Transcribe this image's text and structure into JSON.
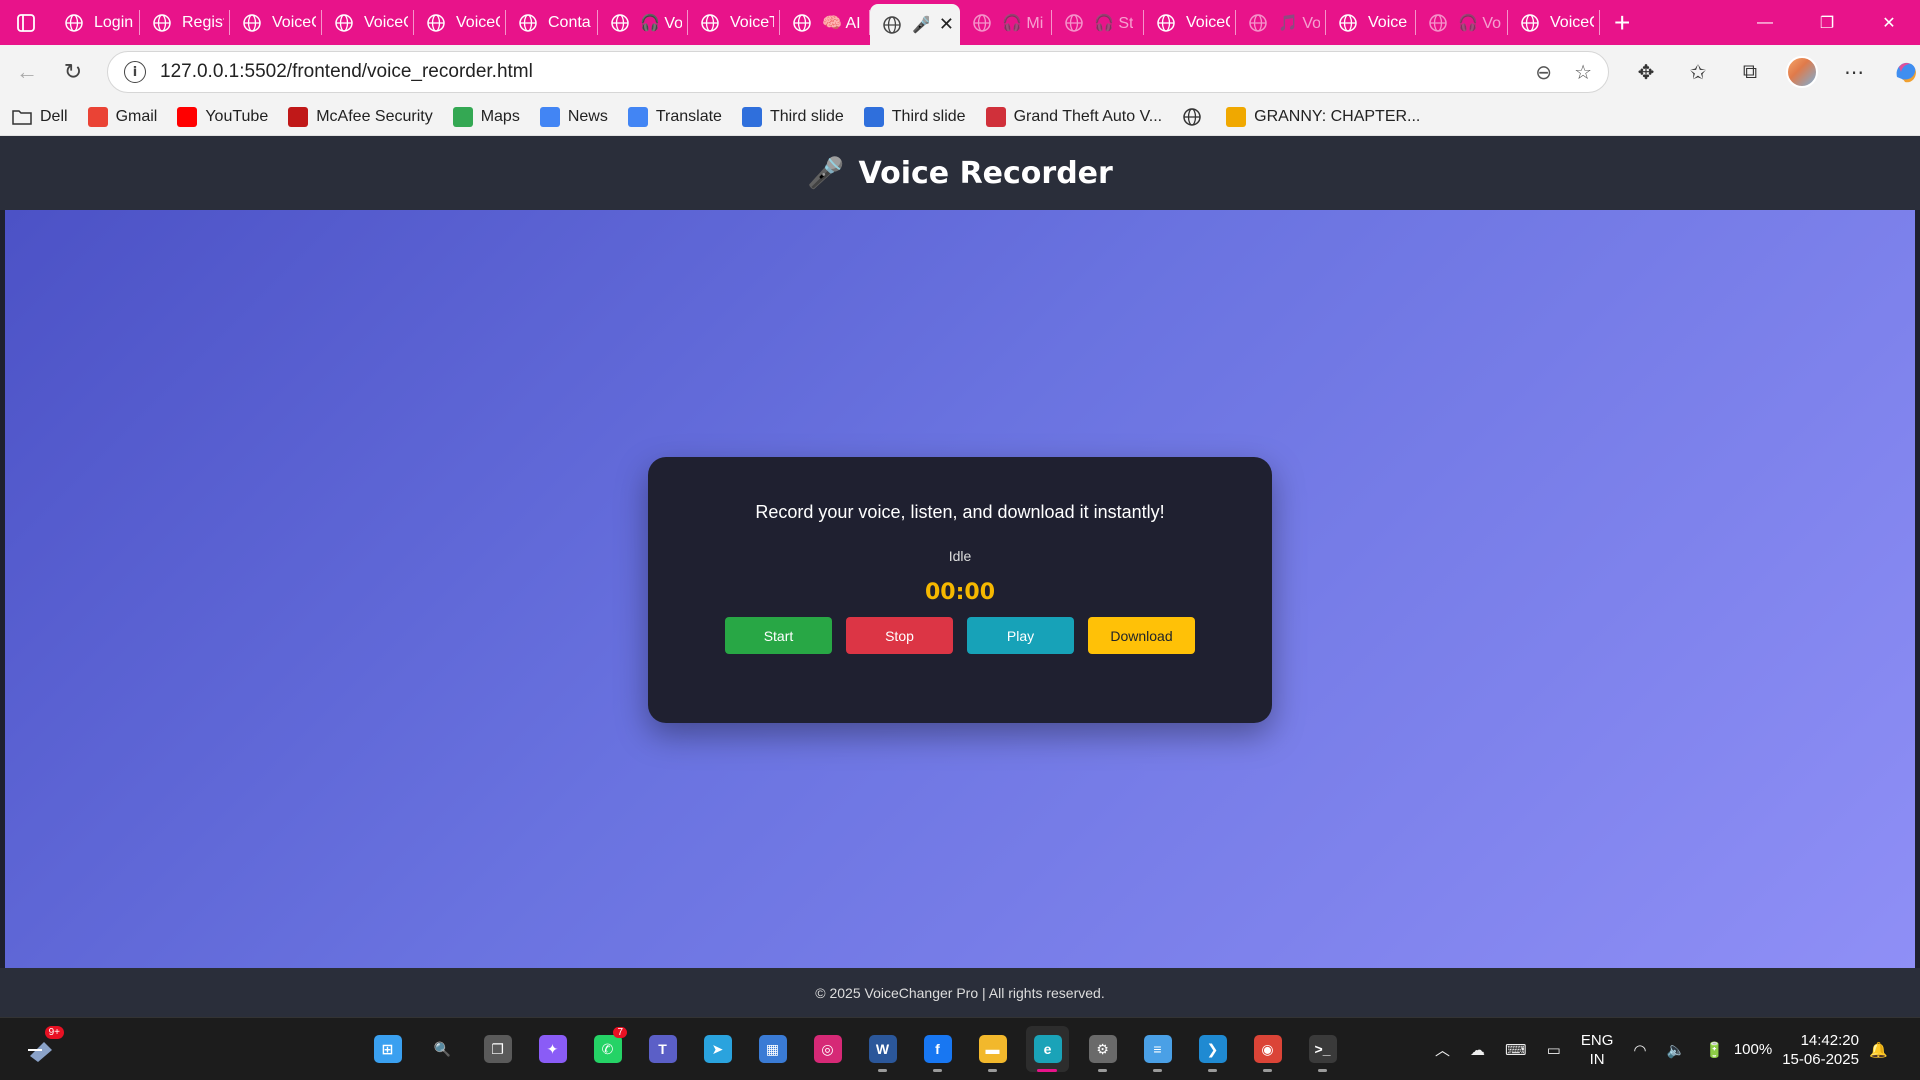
{
  "browser": {
    "tabs": [
      {
        "title": "Login",
        "dim": false
      },
      {
        "title": "Regist",
        "dim": false
      },
      {
        "title": "VoiceC",
        "dim": false
      },
      {
        "title": "VoiceC",
        "dim": false
      },
      {
        "title": "VoiceC",
        "dim": false
      },
      {
        "title": "Conta",
        "dim": false
      },
      {
        "title": "🎧 Vo",
        "dim": false
      },
      {
        "title": "VoiceT",
        "dim": false
      },
      {
        "title": "🧠 AI",
        "dim": false
      },
      {
        "title": "🎤",
        "dim": false,
        "active": true
      },
      {
        "title": "🎧 Mi",
        "dim": true
      },
      {
        "title": "🎧 St",
        "dim": true
      },
      {
        "title": "VoiceC",
        "dim": false
      },
      {
        "title": "🎵 Vo",
        "dim": true
      },
      {
        "title": "Voice",
        "dim": false
      },
      {
        "title": "🎧 Vo",
        "dim": true
      },
      {
        "title": "VoiceC",
        "dim": false
      }
    ],
    "url": "127.0.0.1:5502/frontend/voice_recorder.html",
    "bookmarks": [
      {
        "label": "Dell",
        "icon": "folder-icon",
        "color": "#ffffff"
      },
      {
        "label": "Gmail",
        "icon": "gmail-icon",
        "color": "#ea4335"
      },
      {
        "label": "YouTube",
        "icon": "youtube-icon",
        "color": "#ff0000"
      },
      {
        "label": "McAfee Security",
        "icon": "mcafee-icon",
        "color": "#c01818"
      },
      {
        "label": "Maps",
        "icon": "maps-icon",
        "color": "#34a853"
      },
      {
        "label": "News",
        "icon": "news-icon",
        "color": "#4285f4"
      },
      {
        "label": "Translate",
        "icon": "translate-icon",
        "color": "#4285f4"
      },
      {
        "label": "Third slide",
        "icon": "slide-icon",
        "color": "#2f6fdc"
      },
      {
        "label": "Third slide",
        "icon": "slide-icon",
        "color": "#2f6fdc"
      },
      {
        "label": "Grand Theft Auto V...",
        "icon": "gamepad-icon",
        "color": "#d0303a"
      },
      {
        "label": "",
        "icon": "globe-icon",
        "color": "#333333"
      },
      {
        "label": "GRANNY: CHAPTER...",
        "icon": "crown-icon",
        "color": "#f0a800"
      }
    ]
  },
  "page": {
    "header_title": "Voice Recorder",
    "tagline": "Record your voice, listen, and download it instantly!",
    "status": "Idle",
    "timer": "00:00",
    "buttons": {
      "start": "Start",
      "stop": "Stop",
      "play": "Play",
      "download": "Download"
    },
    "footer": "© 2025 VoiceChanger Pro | All rights reserved."
  },
  "taskbar": {
    "notification_badge": "9+",
    "apps": [
      {
        "name": "start-icon",
        "color": "#3aa0f0",
        "glyph": "⊞"
      },
      {
        "name": "search-icon",
        "color": "transparent",
        "glyph": "🔍"
      },
      {
        "name": "task-view-icon",
        "color": "#5a5a5a",
        "glyph": "❐"
      },
      {
        "name": "copilot-icon",
        "color": "#8a5cf6",
        "glyph": "✦"
      },
      {
        "name": "whatsapp-icon",
        "color": "#25d366",
        "glyph": "✆",
        "badge": "7"
      },
      {
        "name": "teams-icon",
        "color": "#5b5fc7",
        "glyph": "T"
      },
      {
        "name": "telegram-icon",
        "color": "#2aa3de",
        "glyph": "➤"
      },
      {
        "name": "store-icon",
        "color": "#3a7bd5",
        "glyph": "▦"
      },
      {
        "name": "instagram-icon",
        "color": "#d62976",
        "glyph": "◎"
      },
      {
        "name": "word-icon",
        "color": "#2b579a",
        "glyph": "W"
      },
      {
        "name": "facebook-icon",
        "color": "#1877f2",
        "glyph": "f"
      },
      {
        "name": "file-explorer-icon",
        "color": "#f2b82c",
        "glyph": "▬"
      },
      {
        "name": "edge-icon",
        "color": "#1aa3b8",
        "glyph": "e",
        "active": true
      },
      {
        "name": "settings-icon",
        "color": "#6a6a6a",
        "glyph": "⚙"
      },
      {
        "name": "notepad-icon",
        "color": "#4aa0e6",
        "glyph": "≡"
      },
      {
        "name": "vscode-icon",
        "color": "#1f8ad2",
        "glyph": "❯"
      },
      {
        "name": "chrome-icon",
        "color": "#db4437",
        "glyph": "◉"
      },
      {
        "name": "terminal-icon",
        "color": "#3a3a3a",
        "glyph": ">_"
      }
    ],
    "tray": {
      "lang_line1": "ENG",
      "lang_line2": "IN",
      "battery": "100%",
      "time": "14:42:20",
      "date": "15-06-2025"
    }
  },
  "colors": {
    "tabstrip": "#e8138a",
    "start_button": "#28a745",
    "stop_button": "#dc3545",
    "play_button": "#17a2b8",
    "download_button": "#ffc107",
    "timer": "#f5b800"
  }
}
